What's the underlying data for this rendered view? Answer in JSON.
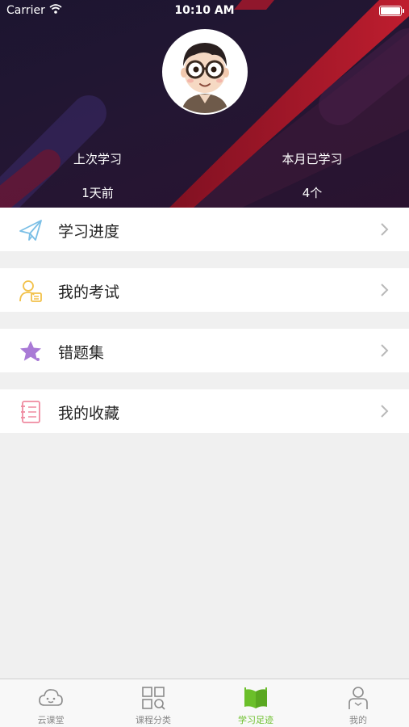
{
  "status_bar": {
    "carrier": "Carrier",
    "time": "10:10 AM"
  },
  "profile": {
    "last_study_label": "上次学习",
    "last_study_value": "1天前",
    "month_study_label": "本月已学习",
    "month_study_value": "4个"
  },
  "menu": [
    {
      "label": "学习进度",
      "icon": "paper-plane-icon",
      "color": "#7bbfe6"
    },
    {
      "label": "我的考试",
      "icon": "exam-user-icon",
      "color": "#f2c14a"
    },
    {
      "label": "错题集",
      "icon": "star-icon",
      "color": "#a97ad6"
    },
    {
      "label": "我的收藏",
      "icon": "notebook-icon",
      "color": "#ef8ba0"
    }
  ],
  "tabs": [
    {
      "label": "云课堂",
      "icon": "cloud-face-icon",
      "active": false
    },
    {
      "label": "课程分类",
      "icon": "grid-search-icon",
      "active": false
    },
    {
      "label": "学习足迹",
      "icon": "open-book-icon",
      "active": true
    },
    {
      "label": "我的",
      "icon": "person-icon",
      "active": false
    }
  ],
  "colors": {
    "accent_green": "#6bbf2a",
    "header_dark": "#1c1530",
    "header_red": "#c0182a",
    "tab_inactive": "#888888"
  }
}
